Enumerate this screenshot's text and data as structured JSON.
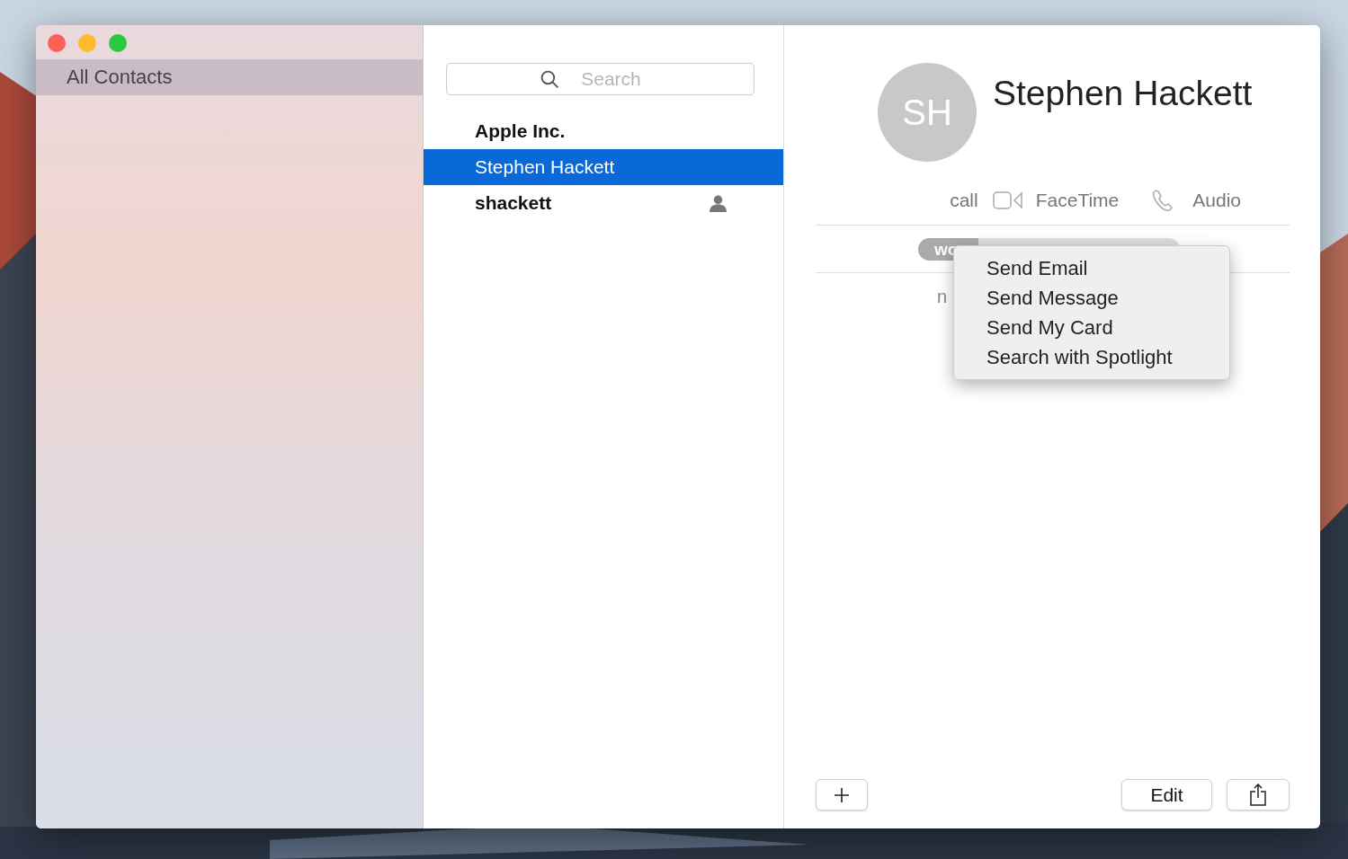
{
  "sidebar": {
    "items": [
      {
        "label": "All Contacts",
        "selected": true
      }
    ]
  },
  "search": {
    "placeholder": "Search"
  },
  "contacts": [
    {
      "name": "Apple Inc.",
      "kind": "company",
      "selected": false
    },
    {
      "name": "Stephen Hackett",
      "kind": "person",
      "selected": true
    },
    {
      "name": "shackett",
      "kind": "me",
      "selected": false
    }
  ],
  "card": {
    "initials": "SH",
    "name": "Stephen Hackett",
    "actions": [
      {
        "kind": "label",
        "text": "call"
      },
      {
        "kind": "facetime",
        "text": "FaceTime"
      },
      {
        "kind": "audio",
        "text": "Audio"
      }
    ],
    "fields": [
      {
        "kind": "pill",
        "label": "wo"
      },
      {
        "kind": "plain",
        "label": "n"
      }
    ]
  },
  "context_menu": {
    "items": [
      "Send Email",
      "Send Message",
      "Send My Card",
      "Search with Spotlight"
    ]
  },
  "footer": {
    "edit": "Edit"
  }
}
